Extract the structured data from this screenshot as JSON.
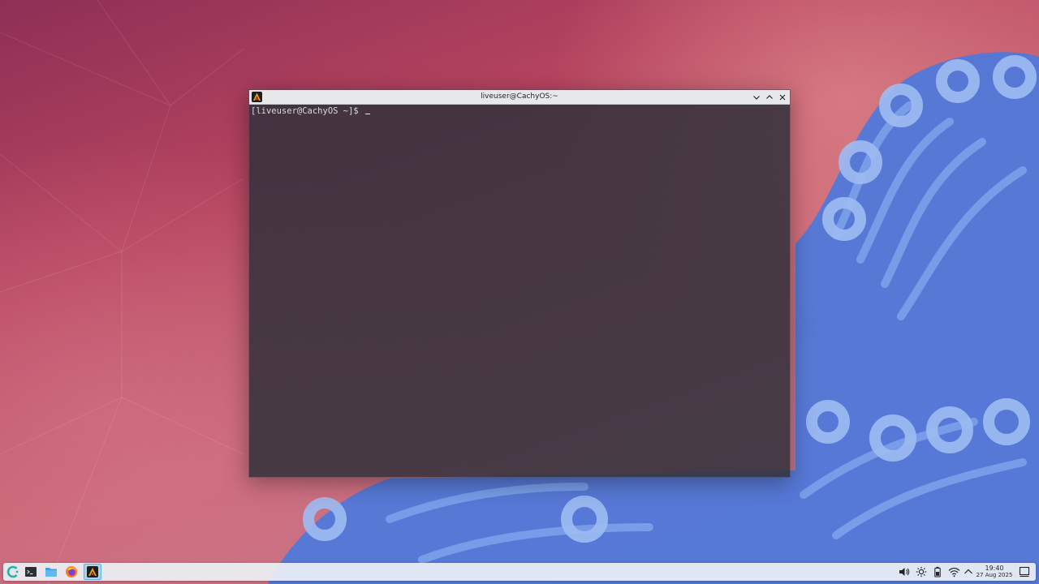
{
  "window": {
    "title": "liveuser@CachyOS:~",
    "prompt": "[liveuser@CachyOS ~]$"
  },
  "taskbar": {
    "apps": [
      {
        "icon": "cachyos-launcher-icon"
      },
      {
        "icon": "terminal-icon"
      },
      {
        "icon": "files-icon"
      },
      {
        "icon": "firefox-icon"
      },
      {
        "icon": "alacritty-icon",
        "active": true
      }
    ],
    "tray": [
      "volume-icon",
      "brightness-icon",
      "battery-icon",
      "wifi-icon",
      "chevron-up-icon",
      "show-desktop-icon"
    ],
    "clock": {
      "time": "19:40",
      "date": "27 Aug 2025"
    }
  },
  "colors": {
    "accent": "#3daee9",
    "terminal_bg": "#34323c",
    "titlebar": "#e6e8ea",
    "wallpaper_blue": "#4a73d8"
  }
}
